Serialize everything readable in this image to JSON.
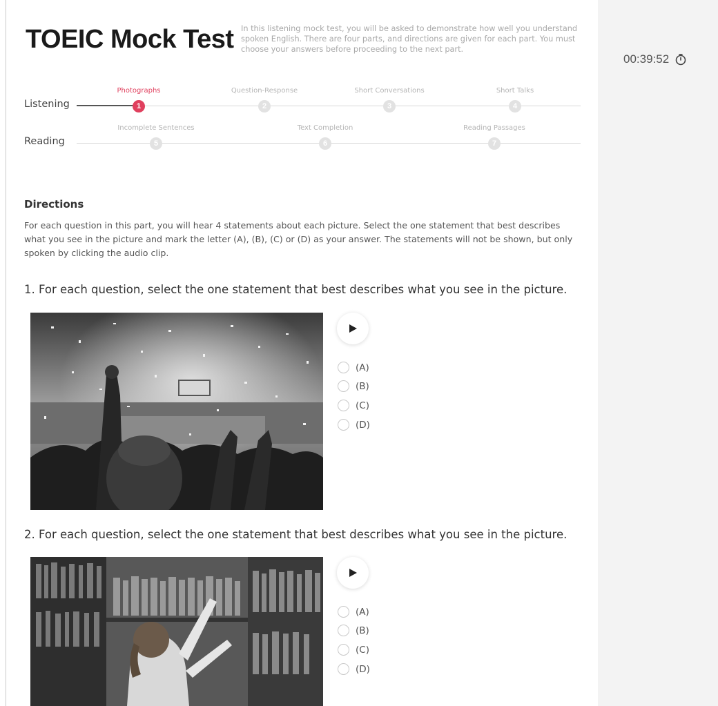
{
  "header": {
    "title": "TOEIC Mock Test",
    "intro": "In this listening mock test, you will be asked to demonstrate how well you understand spoken English. There are four parts, and directions are given for each part. You must choose your answers before proceeding to the next part."
  },
  "timer": {
    "value": "00:39:52",
    "icon": "stopwatch-icon"
  },
  "progress": {
    "listening": {
      "label": "Listening",
      "steps": [
        {
          "title": "Photographs",
          "number": "1",
          "active": true
        },
        {
          "title": "Question-Response",
          "number": "2"
        },
        {
          "title": "Short Conversations",
          "number": "3"
        },
        {
          "title": "Short Talks",
          "number": "4"
        }
      ]
    },
    "reading": {
      "label": "Reading",
      "steps": [
        {
          "title": "Incomplete Sentences",
          "number": "5"
        },
        {
          "title": "Text Completion",
          "number": "6"
        },
        {
          "title": "Reading Passages",
          "number": "7"
        }
      ]
    }
  },
  "directions": {
    "title": "Directions",
    "text": "For each question in this part, you will hear 4 statements about each picture. Select the one statement that best describes what you see in the picture and mark the letter (A), (B), (C) or (D) as your answer. The statements will not be shown, but only spoken by clicking the audio clip."
  },
  "questions": [
    {
      "title": "1. For each question, select the one statement that best describes what you see in the picture.",
      "options": [
        "(A)",
        "(B)",
        "(C)",
        "(D)"
      ]
    },
    {
      "title": "2. For each question, select the one statement that best describes what you see in the picture.",
      "options": [
        "(A)",
        "(B)",
        "(C)",
        "(D)"
      ]
    }
  ],
  "colors": {
    "accent": "#e0405e",
    "sidebar": "#f3f3f3"
  }
}
